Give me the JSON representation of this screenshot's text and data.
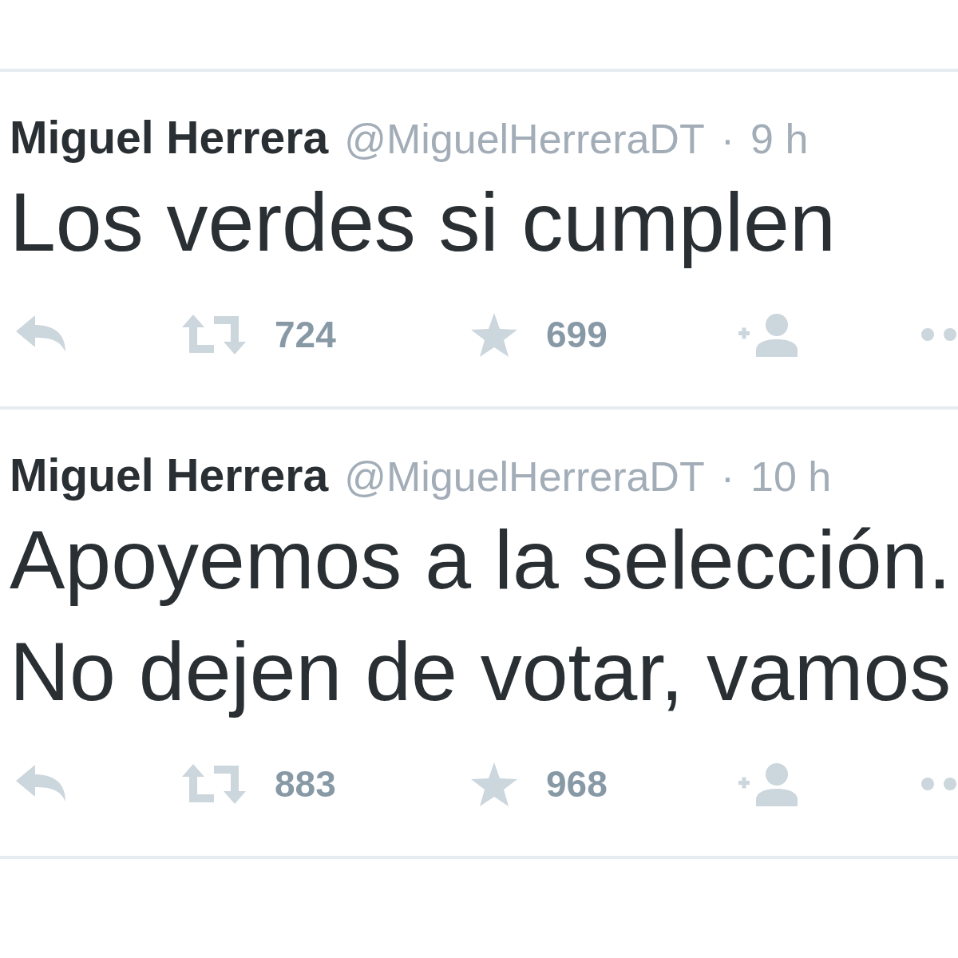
{
  "tweets": [
    {
      "name": "Miguel Herrera",
      "handle": "@MiguelHerreraDT",
      "separator": "·",
      "time": "9 h",
      "text_lines": [
        "Los verdes si cumplen"
      ],
      "retweets": "724",
      "favorites": "699"
    },
    {
      "name": "Miguel Herrera",
      "handle": "@MiguelHerreraDT",
      "separator": "·",
      "time": "10 h",
      "text_lines": [
        "Apoyemos a la selección.",
        "No dejen de votar, vamos"
      ],
      "retweets": "883",
      "favorites": "968"
    }
  ]
}
